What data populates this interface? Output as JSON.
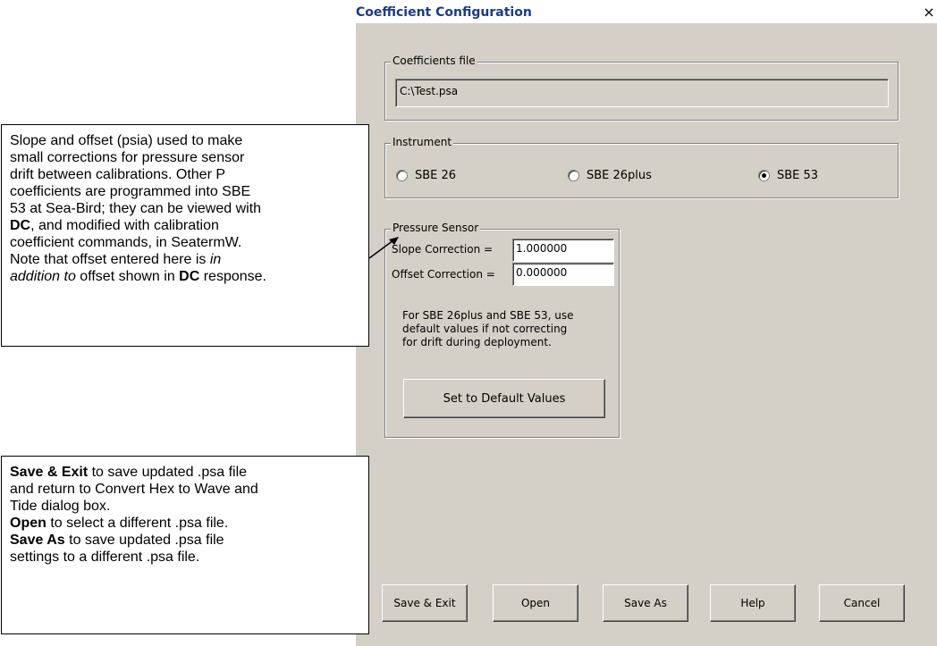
{
  "window": {
    "title": "Coefficient Configuration",
    "close_symbol": "×"
  },
  "coefficients_file": {
    "legend": "Coefficients file",
    "value": "C:\\Test.psa"
  },
  "instrument": {
    "legend": "Instrument",
    "options": [
      {
        "label": "SBE 26",
        "selected": false
      },
      {
        "label": "SBE 26plus",
        "selected": false
      },
      {
        "label": "SBE 53",
        "selected": true
      }
    ]
  },
  "pressure_sensor": {
    "legend": "Pressure Sensor",
    "slope_label": "Slope Correction =",
    "slope_value": "1.000000",
    "offset_label": "Offset Correction =",
    "offset_value": "0.000000",
    "note_line1": "For SBE 26plus and SBE 53, use",
    "note_line2": "default values if not  correcting",
    "note_line3": "for drift during deployment.",
    "default_button": "Set to Default Values"
  },
  "buttons": {
    "save_exit": "Save & Exit",
    "open": "Open",
    "save_as": "Save As",
    "help": "Help",
    "cancel": "Cancel"
  },
  "callout_pressure": {
    "l1": "Slope and offset (psia) used to make",
    "l2": "small corrections for pressure sensor",
    "l3": "drift between calibrations. Other P",
    "l4": "coefficients are programmed into SBE",
    "l5": "53 at Sea-Bird; they can be viewed with",
    "l6_bold": "DC",
    "l6_rest": ", and modified with calibration",
    "l7": "coefficient commands, in SeatermW.",
    "l8_pre": "Note that offset entered here is ",
    "l8_italic": "in",
    "l9_italic": "addition to",
    "l9_mid": " offset shown in ",
    "l9_bold": "DC",
    "l9_end": " response."
  },
  "callout_buttons": {
    "a_bold": "Save & Exit",
    "a_rest": " to save updated .psa file",
    "a2": "and return to Convert Hex to Wave and",
    "a3": "Tide dialog box.",
    "b_bold": "Open",
    "b_rest": " to select a different .psa file.",
    "c_bold": "Save As",
    "c_rest": " to save updated .psa file",
    "c2": "settings to a different .psa file."
  }
}
